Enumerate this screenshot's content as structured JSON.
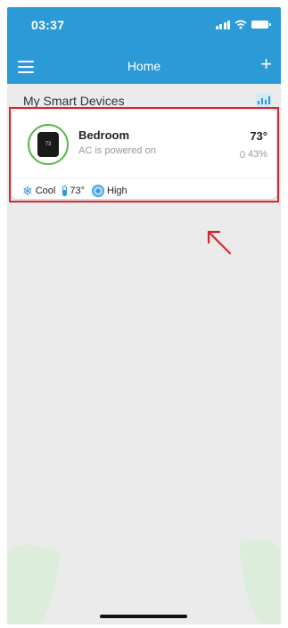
{
  "status_bar": {
    "time": "03:37"
  },
  "app_bar": {
    "title": "Home"
  },
  "section": {
    "title": "My Smart Devices"
  },
  "device": {
    "name": "Bedroom",
    "status": "AC is powered on",
    "temperature": "73°",
    "humidity": "43%",
    "thumbnail_text": "73",
    "mode": "Cool",
    "setpoint": "73°",
    "fan": "High"
  },
  "colors": {
    "header": "#2d9ad8",
    "background": "#ebebeb",
    "highlight": "#d9252e",
    "ring": "#57b84a"
  },
  "icons": [
    "menu-icon",
    "add-icon",
    "stats-icon",
    "snowflake-icon",
    "thermometer-icon",
    "fan-icon",
    "droplet-icon"
  ]
}
